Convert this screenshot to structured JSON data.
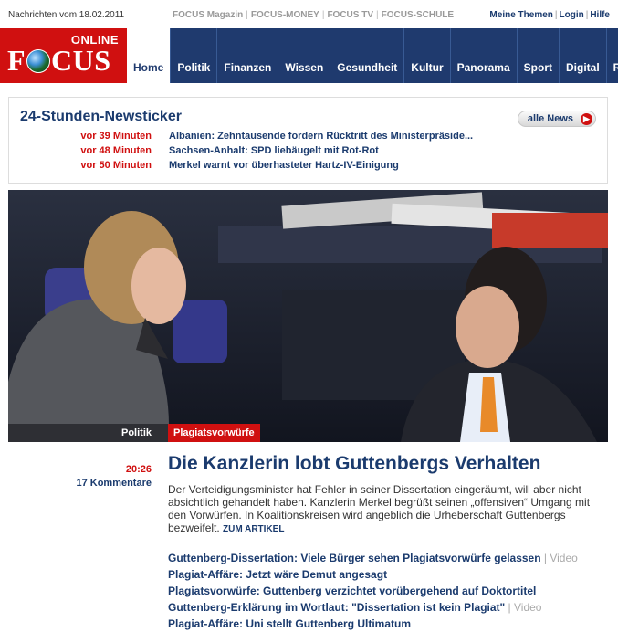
{
  "topbar": {
    "date": "Nachrichten vom 18.02.2011",
    "links": [
      "FOCUS Magazin",
      "FOCUS-MONEY",
      "FOCUS TV",
      "FOCUS-SCHULE"
    ],
    "user_links": [
      "Meine Themen",
      "Login",
      "Hilfe"
    ]
  },
  "logo": {
    "online": "ONLINE",
    "focus_f": "F",
    "focus_rest": "CUS"
  },
  "nav": {
    "items": [
      "Home",
      "Politik",
      "Finanzen",
      "Wissen",
      "Gesundheit",
      "Kultur",
      "Panorama",
      "Sport",
      "Digital",
      "Reis"
    ],
    "active": "Home"
  },
  "ticker": {
    "title": "24-Stunden-Newsticker",
    "all_news": "alle News",
    "items": [
      {
        "time": "vor 39 Minuten",
        "text": "Albanien: Zehntausende fordern Rücktritt des Ministerpräside..."
      },
      {
        "time": "vor 48 Minuten",
        "text": "Sachsen-Anhalt: SPD liebäugelt mit Rot-Rot"
      },
      {
        "time": "vor 50 Minuten",
        "text": "Merkel warnt vor überhasteter Hartz-IV-Einigung"
      }
    ]
  },
  "hero": {
    "category": "Politik",
    "tag": "Plagiatsvorwürfe"
  },
  "article": {
    "time": "20:26",
    "comments": "17 Kommentare",
    "headline": "Die Kanzlerin lobt Guttenbergs Verhalten",
    "teaser": "Der Verteidigungsminister hat Fehler in seiner Dissertation eingeräumt, will aber nicht absichtlich gehandelt haben. Kanzlerin Merkel begrüßt seinen „offensiven“ Umgang mit den Vorwürfen. In Koalitionskreisen wird angeblich die Urheberschaft Guttenbergs bezweifelt.",
    "more": "ZUM ARTIKEL",
    "related": [
      {
        "text": "Guttenberg-Dissertation: Viele Bürger sehen Plagiatsvorwürfe gelassen",
        "suffix": " | Video"
      },
      {
        "text": "Plagiat-Affäre: Jetzt wäre Demut angesagt",
        "suffix": ""
      },
      {
        "text": "Plagiatsvorwürfe: Guttenberg verzichtet vorübergehend auf Doktortitel",
        "suffix": ""
      },
      {
        "text": "Guttenberg-Erklärung im Wortlaut: \"Dissertation ist kein Plagiat\"",
        "suffix": " | Video"
      },
      {
        "text": "Plagiat-Affäre: Uni stellt Guttenberg Ultimatum",
        "suffix": ""
      }
    ]
  },
  "colors": {
    "brand_red": "#d01010",
    "navy": "#1f3a6e",
    "link_blue": "#1b3b6e"
  }
}
